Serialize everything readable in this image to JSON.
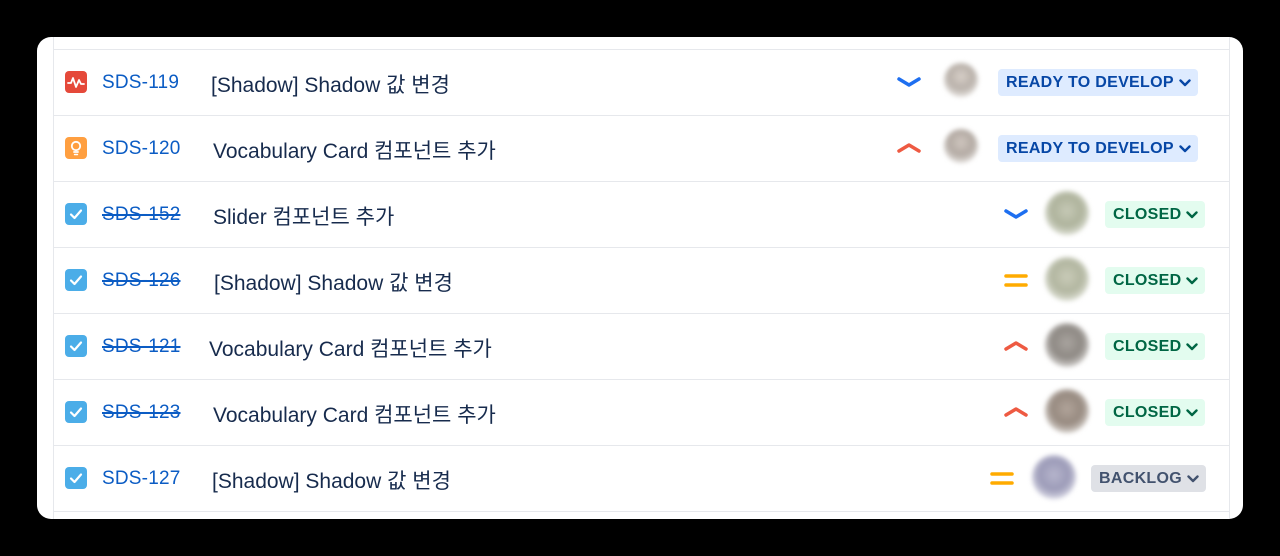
{
  "colors": {
    "bug": "#e5493a",
    "improvement": "#ff9f40",
    "task": "#4bade8",
    "link": "#0b5cc4",
    "priority_high": "#ee5a42",
    "priority_low": "#1e6ff0",
    "priority_medium": "#ffab00"
  },
  "issues": [
    {
      "type_icon": "bug-icon",
      "key": "SDS-119",
      "summary": "[Shadow] Shadow 값 변경",
      "priority_icon": "priority-low-icon",
      "status": "READY TO DEVELOP"
    },
    {
      "type_icon": "lightbulb-icon",
      "key": "SDS-120",
      "summary": "Vocabulary Card 컴포넌트 추가",
      "priority_icon": "priority-high-icon",
      "status": "READY TO DEVELOP"
    },
    {
      "type_icon": "checkbox-icon",
      "key": "SDS-152",
      "summary": "Slider 컴포넌트 추가",
      "priority_icon": "priority-low-icon",
      "status": "CLOSED"
    },
    {
      "type_icon": "checkbox-icon",
      "key": "SDS-126",
      "summary": "[Shadow] Shadow 값 변경",
      "priority_icon": "priority-medium-icon",
      "status": "CLOSED"
    },
    {
      "type_icon": "checkbox-icon",
      "key": "SDS-121",
      "summary": "Vocabulary Card 컴포넌트 추가",
      "priority_icon": "priority-high-icon",
      "status": "CLOSED"
    },
    {
      "type_icon": "checkbox-icon",
      "key": "SDS-123",
      "summary": "Vocabulary Card 컴포넌트 추가",
      "priority_icon": "priority-high-icon",
      "status": "CLOSED"
    },
    {
      "type_icon": "checkbox-icon",
      "key": "SDS-127",
      "summary": "[Shadow] Shadow 값 변경",
      "priority_icon": "priority-medium-icon",
      "status": "BACKLOG"
    }
  ]
}
